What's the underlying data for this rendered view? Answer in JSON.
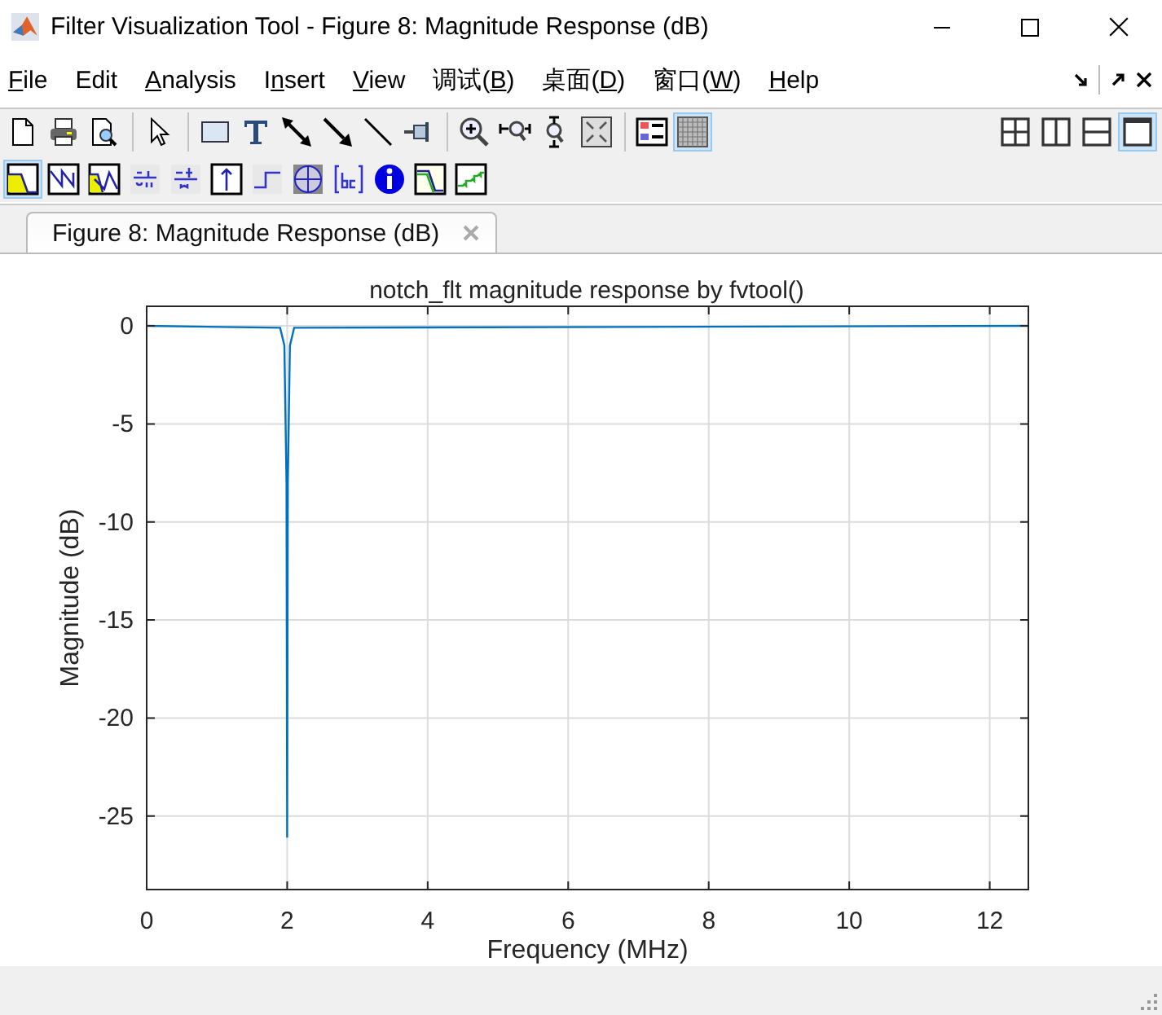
{
  "window": {
    "title": "Filter Visualization Tool - Figure 8: Magnitude Response (dB)"
  },
  "menu": [
    {
      "key": "F",
      "after": "ile"
    },
    {
      "before": "Edit"
    },
    {
      "key": "A",
      "after": "nalysis"
    },
    {
      "before": "I",
      "key": "n",
      "after": "sert"
    },
    {
      "key": "V",
      "after": "iew"
    },
    {
      "before": "调试(",
      "key": "B",
      "after": ")"
    },
    {
      "before": "桌面(",
      "key": "D",
      "after": ")"
    },
    {
      "before": "窗口(",
      "key": "W",
      "after": ")"
    },
    {
      "key": "H",
      "after": "elp"
    }
  ],
  "toolbar": {
    "groups": [
      [
        {
          "kind": "new",
          "selected": false
        },
        {
          "kind": "print",
          "selected": false
        },
        {
          "kind": "preview",
          "selected": false
        }
      ],
      [
        {
          "kind": "pointer",
          "selected": false
        }
      ],
      [
        {
          "kind": "rectangle",
          "selected": false
        },
        {
          "kind": "text",
          "selected": false
        },
        {
          "kind": "double-arrow",
          "selected": false
        },
        {
          "kind": "arrow",
          "selected": false
        },
        {
          "kind": "line",
          "selected": false
        },
        {
          "kind": "pin",
          "selected": false
        }
      ],
      [
        {
          "kind": "zoom-in",
          "selected": false
        },
        {
          "kind": "zoom-x",
          "selected": false
        },
        {
          "kind": "zoom-y",
          "selected": false
        },
        {
          "kind": "fit",
          "selected": false
        }
      ],
      [
        {
          "kind": "legend",
          "selected": false
        },
        {
          "kind": "grid",
          "selected": true
        }
      ]
    ],
    "layouts": [
      {
        "kind": "grid4",
        "selected": false
      },
      {
        "kind": "columns",
        "selected": false
      },
      {
        "kind": "rows",
        "selected": false
      },
      {
        "kind": "single",
        "selected": true
      }
    ]
  },
  "analysis_toolbar": [
    {
      "kind": "magnitude",
      "selected": true
    },
    {
      "kind": "phase",
      "selected": false
    },
    {
      "kind": "mag-phase",
      "selected": false
    },
    {
      "kind": "group-delay",
      "selected": false
    },
    {
      "kind": "phase-delay",
      "selected": false
    },
    {
      "kind": "impulse",
      "selected": false
    },
    {
      "kind": "step",
      "selected": false
    },
    {
      "kind": "pole-zero",
      "selected": false
    },
    {
      "kind": "coefficients",
      "selected": false
    },
    {
      "kind": "info",
      "selected": false
    },
    {
      "kind": "mag-estimate",
      "selected": false
    },
    {
      "kind": "noise-power",
      "selected": false
    }
  ],
  "tabs": [
    {
      "label": "Figure 8: Magnitude Response (dB)",
      "selected": true
    }
  ],
  "plot": {
    "chart_data": {
      "type": "line",
      "title": "notch_flt magnitude response by fvtool()",
      "xlabel": "Frequency (MHz)",
      "ylabel": "Magnitude (dB)",
      "x": [
        0,
        1.9,
        1.96,
        1.99,
        2.0,
        2.01,
        2.04,
        2.1,
        12.55
      ],
      "grid": true,
      "series": [
        {
          "color": "#0072bd",
          "values": [
            0,
            -0.1,
            -1,
            -8,
            -26.1,
            -8,
            -1,
            -0.1,
            0
          ]
        }
      ],
      "xlim": [
        0,
        12.55
      ],
      "ylim": [
        -28.75,
        1
      ],
      "xticks": [
        0,
        2,
        4,
        6,
        8,
        10,
        12
      ],
      "yticks": [
        -25,
        -20,
        -15,
        -10,
        -5,
        0
      ]
    }
  }
}
